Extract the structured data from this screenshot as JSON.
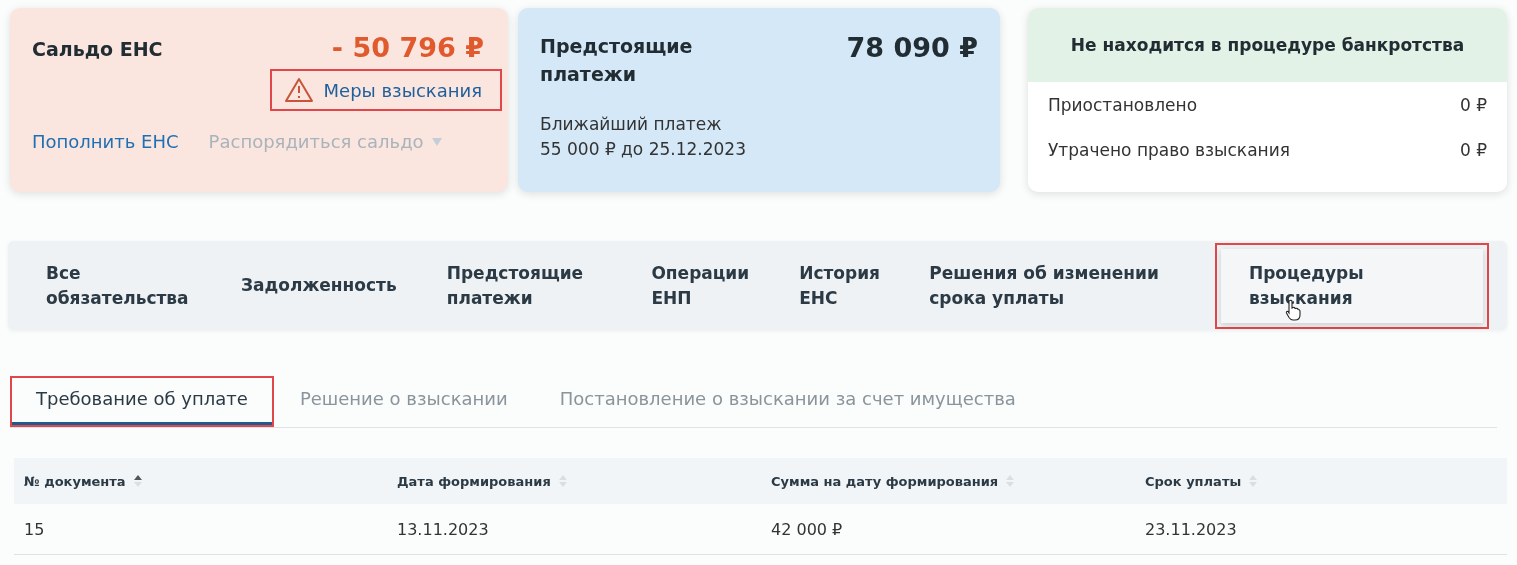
{
  "balance_card": {
    "title": "Сальдо ЕНС",
    "amount": "- 50 796 ₽",
    "measures_link": {
      "label": "Меры взыскания",
      "highlighted": true
    },
    "top_up_link": "Пополнить ЕНС",
    "manage_button": {
      "label": "Распорядиться сальдо",
      "disabled": true
    }
  },
  "upcoming_card": {
    "title": "Предстоящие платежи",
    "amount": "78 090 ₽",
    "next_label": "Ближайший платеж",
    "next_value": "55 000 ₽ до 25.12.2023"
  },
  "bankruptcy_card": {
    "status": "Не находится в процедуре банкротства",
    "rows": [
      {
        "label": "Приостановлено",
        "value": "0 ₽"
      },
      {
        "label": "Утрачено право взыскания",
        "value": "0 ₽"
      }
    ]
  },
  "tabs": [
    {
      "label": "Все обязательства",
      "selected": false,
      "highlighted": false
    },
    {
      "label": "Задолженность",
      "selected": false,
      "highlighted": false
    },
    {
      "label": "Предстоящие платежи",
      "selected": false,
      "highlighted": false
    },
    {
      "label": "Операции ЕНП",
      "selected": false,
      "highlighted": false
    },
    {
      "label": "История ЕНС",
      "selected": false,
      "highlighted": false
    },
    {
      "label": "Решения об изменении срока уплаты",
      "selected": false,
      "highlighted": false
    },
    {
      "label": "Процедуры взыскания",
      "selected": true,
      "highlighted": true
    }
  ],
  "subtabs": [
    {
      "label": "Требование об уплате",
      "selected": true,
      "highlighted": true
    },
    {
      "label": "Решение о взыскании",
      "selected": false,
      "highlighted": false
    },
    {
      "label": "Постановление о взыскании за счет имущества",
      "selected": false,
      "highlighted": false
    }
  ],
  "table": {
    "columns": [
      {
        "label": "№ документа",
        "sorted": true
      },
      {
        "label": "Дата формирования",
        "sorted": false
      },
      {
        "label": "Сумма на дату формирования",
        "sorted": false
      },
      {
        "label": "Срок уплаты",
        "sorted": false
      }
    ],
    "rows": [
      [
        "15",
        "13.11.2023",
        "42 000 ₽",
        "23.11.2023"
      ]
    ]
  }
}
